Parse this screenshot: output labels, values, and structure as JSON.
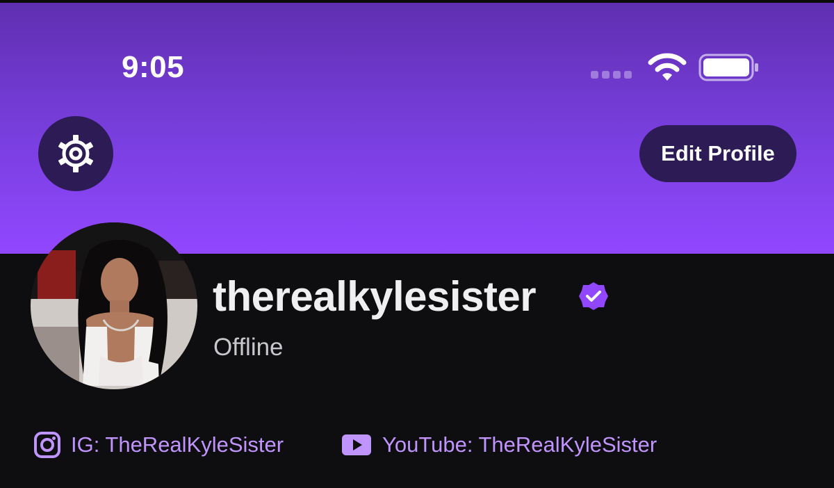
{
  "status_bar": {
    "time": "9:05",
    "icons": [
      "signal-dots-icon",
      "wifi-icon",
      "battery-icon"
    ]
  },
  "header": {
    "settings_icon": "gear-icon",
    "edit_profile_label": "Edit Profile"
  },
  "profile": {
    "username": "therealkylesister",
    "verified": true,
    "status": "Offline"
  },
  "social_links": [
    {
      "icon": "instagram-icon",
      "label": "IG: TheRealKyleSister"
    },
    {
      "icon": "youtube-icon",
      "label": "YouTube: TheRealKyleSister"
    }
  ],
  "colors": {
    "header_top": "#5f2fb0",
    "header_bottom": "#9147ff",
    "button_bg": "#2d1b56",
    "page_bg": "#0e0e10",
    "link": "#bf94ff",
    "verified_badge": "#9147ff"
  }
}
